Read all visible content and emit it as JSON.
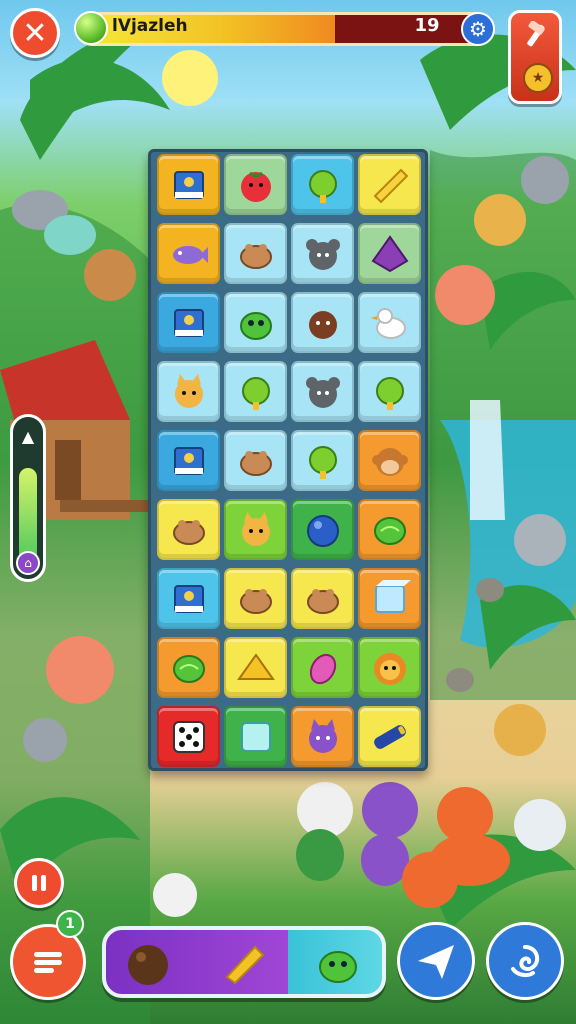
{
  "header": {
    "close_icon": "close-x-icon",
    "progress_title": "lVjazleh",
    "progress_value": 19,
    "progress_fill_fraction": 0.62,
    "gear_icon": "gear-icon",
    "hammer_icon": "hammer-icon",
    "hammer_badge_icon": "star-lock-icon"
  },
  "side_slider": {
    "level_fraction": 0.7,
    "arrow_icon": "arrow-up-icon",
    "knob_icon": "house-icon"
  },
  "board": {
    "columns": 4,
    "rows": 9,
    "tiles": [
      [
        "book",
        "tomato",
        "green-fruit",
        "banana"
      ],
      [
        "purple-fish",
        "hamster",
        "gray-mouse",
        "purple-gem"
      ],
      [
        "book",
        "green-blob",
        "chocolate-blob",
        "goose"
      ],
      [
        "cat",
        "green-fruit",
        "gray-mouse",
        "green-fruit"
      ],
      [
        "book",
        "hamster",
        "green-fruit",
        "monkey"
      ],
      [
        "hamster",
        "cat",
        "blue-ball",
        "green-ball"
      ],
      [
        "book",
        "hamster",
        "hamster",
        "ice-cube"
      ],
      [
        "green-ball",
        "cheese-wedge",
        "pink-egg",
        "lion"
      ],
      [
        "dice",
        "mint-square",
        "purple-cat",
        "blue-battery"
      ]
    ],
    "tile_colors": [
      [
        "#f4b321",
        "#9fd79a",
        "#4fc4ea",
        "#f7e74e"
      ],
      [
        "#f4b321",
        "#a7e4f5",
        "#a7e4f5",
        "#9fd79a"
      ],
      [
        "#3ba9e0",
        "#a7e4f5",
        "#a7e4f5",
        "#a7e4f5"
      ],
      [
        "#a7e4f5",
        "#a7e4f5",
        "#a7e4f5",
        "#a7e4f5"
      ],
      [
        "#3ba9e0",
        "#a7e4f5",
        "#a7e4f5",
        "#f49a2e"
      ],
      [
        "#f7e74e",
        "#7fd33a",
        "#3fb34a",
        "#f49a2e"
      ],
      [
        "#4fc4ea",
        "#f7e74e",
        "#f7e74e",
        "#f49a2e"
      ],
      [
        "#f49a2e",
        "#f7e74e",
        "#7fd33a",
        "#7fd33a"
      ],
      [
        "#e62a2a",
        "#3fb34a",
        "#f49a2e",
        "#f7e74e"
      ]
    ]
  },
  "bottom": {
    "pause_icon": "pause-icon",
    "menu_icon": "menu-icon",
    "menu_badge": "1",
    "tray_items": [
      "coconut-icon",
      "banana-icon",
      "green-blob-icon"
    ],
    "plane_icon": "paper-plane-icon",
    "swirl_icon": "swirl-icon"
  }
}
